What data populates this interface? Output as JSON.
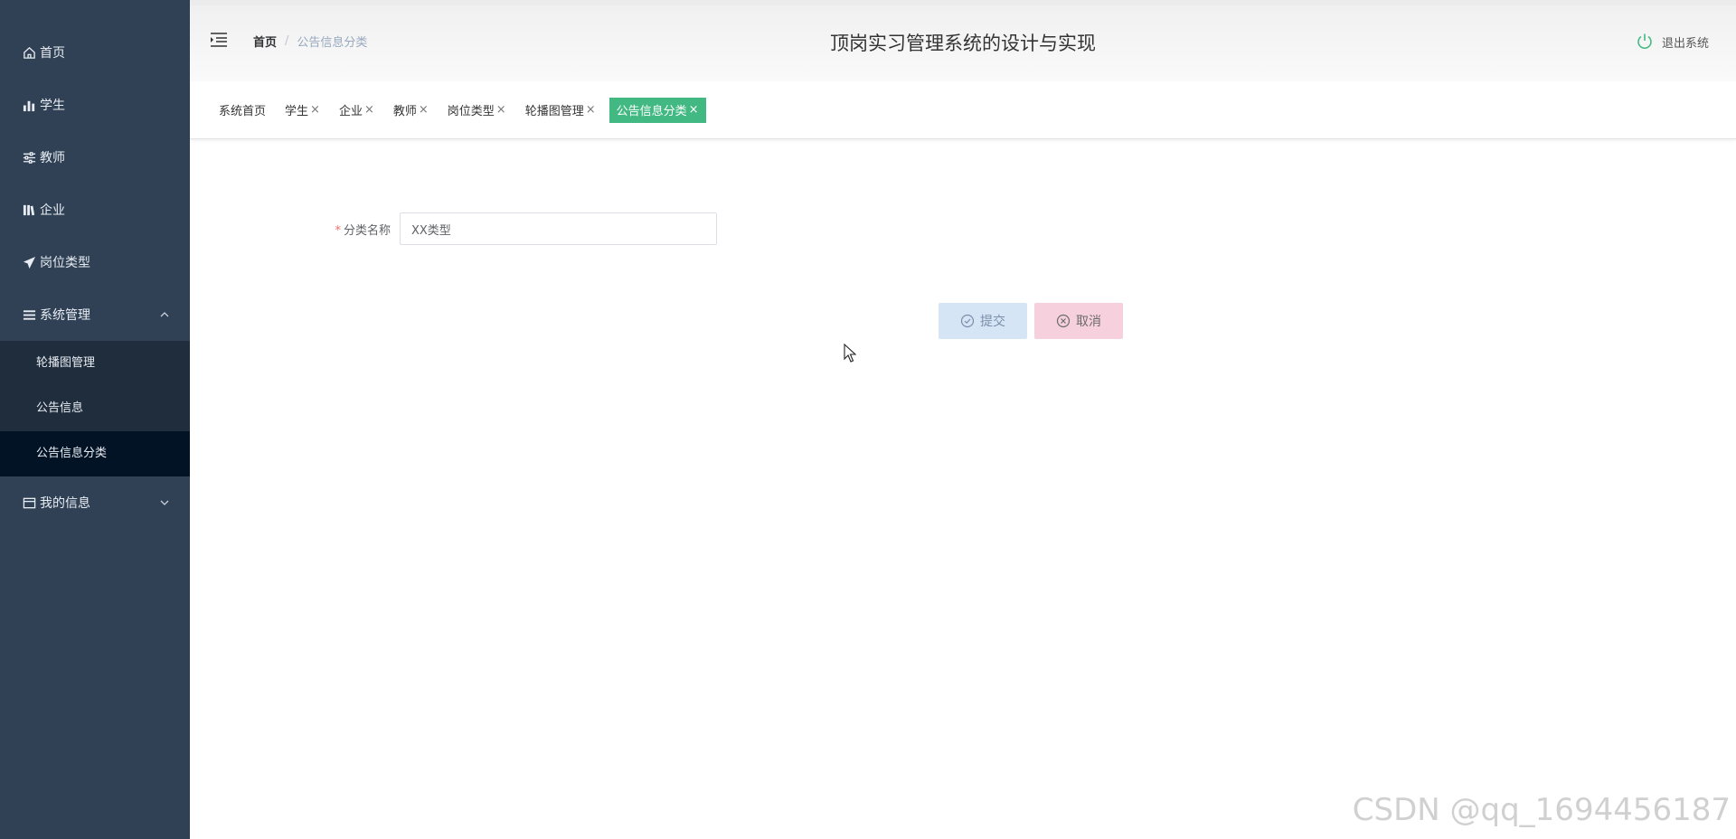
{
  "sidebar": {
    "items": [
      {
        "label": "首页",
        "icon": "home-icon"
      },
      {
        "label": "学生",
        "icon": "bar-chart-icon"
      },
      {
        "label": "教师",
        "icon": "sliders-icon"
      },
      {
        "label": "企业",
        "icon": "library-icon"
      },
      {
        "label": "岗位类型",
        "icon": "send-icon"
      },
      {
        "label": "系统管理",
        "icon": "menu-icon",
        "expanded": true
      },
      {
        "label": "我的信息",
        "icon": "card-icon",
        "expanded": false
      }
    ],
    "submenu": [
      {
        "label": "轮播图管理"
      },
      {
        "label": "公告信息"
      },
      {
        "label": "公告信息分类",
        "active": true
      }
    ]
  },
  "header": {
    "breadcrumb_home": "首页",
    "breadcrumb_sep": "/",
    "breadcrumb_current": "公告信息分类",
    "title": "顶岗实习管理系统的设计与实现",
    "logout_label": "退出系统"
  },
  "tags": [
    {
      "label": "系统首页",
      "closable": false
    },
    {
      "label": "学生",
      "closable": true
    },
    {
      "label": "企业",
      "closable": true
    },
    {
      "label": "教师",
      "closable": true
    },
    {
      "label": "岗位类型",
      "closable": true
    },
    {
      "label": "轮播图管理",
      "closable": true
    },
    {
      "label": "公告信息分类",
      "closable": true,
      "active": true
    }
  ],
  "tag_close": "×",
  "form": {
    "required_mark": "*",
    "label": "分类名称",
    "value": "XX类型",
    "submit_label": "提交",
    "cancel_label": "取消"
  },
  "watermark": "CSDN @qq_1694456187",
  "colors": {
    "sidebar_bg": "#304156",
    "submenu_bg": "#1f2d3d",
    "active_tag": "#42b983",
    "submit_bg": "#d6e5f6",
    "cancel_bg": "#f7d0dd"
  }
}
